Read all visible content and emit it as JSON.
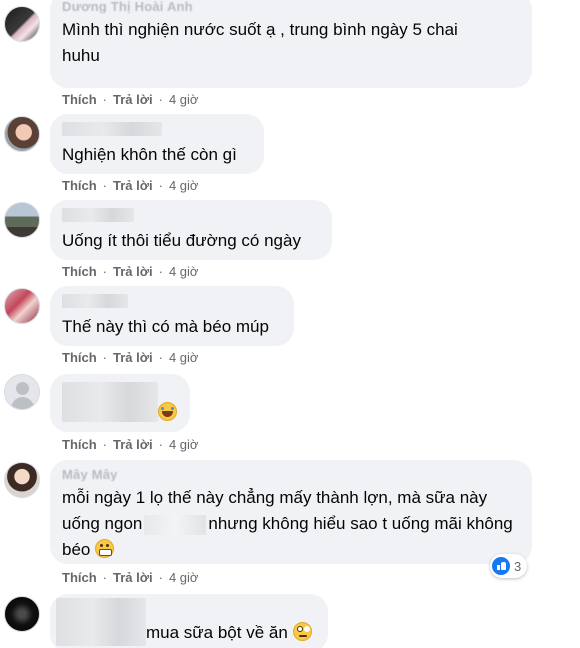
{
  "actions": {
    "like": "Thích",
    "reply": "Trả lời",
    "separator": "·"
  },
  "comments": [
    {
      "author": "Dương Thị Hoài Anh",
      "text_line1": "Mình thì nghiện nước suốt ạ , trung bình ngày 5 chai",
      "text_line2": "huhu",
      "time": "4 giờ"
    },
    {
      "author": "",
      "text_line1": "Nghiện khôn thế còn gì",
      "time": "4 giờ"
    },
    {
      "author": "",
      "text_line1": "Uống ít thôi tiểu đường có ngày",
      "time": "4 giờ"
    },
    {
      "author": "",
      "text_line1": "Thế này thì có mà béo múp",
      "time": "4 giờ"
    },
    {
      "author": "",
      "emoji": "laughing-crying-emoji",
      "time": "4 giờ"
    },
    {
      "author": "Mây Mây",
      "text_line1": "mỗi ngày 1 lọ thế này chẳng mấy thành lợn, mà sữa này",
      "text_line2a": "uống ngon",
      "text_line2b": "nhưng không hiểu sao t uống mãi không",
      "text_line3": "béo",
      "time": "4 giờ",
      "reaction_count": "3"
    },
    {
      "author": "",
      "text_line1": "mua sữa bột về ăn"
    }
  ],
  "colors": {
    "bubble": "#f0f2f5",
    "meta": "#65676b",
    "like_blue": "#1877f2"
  }
}
